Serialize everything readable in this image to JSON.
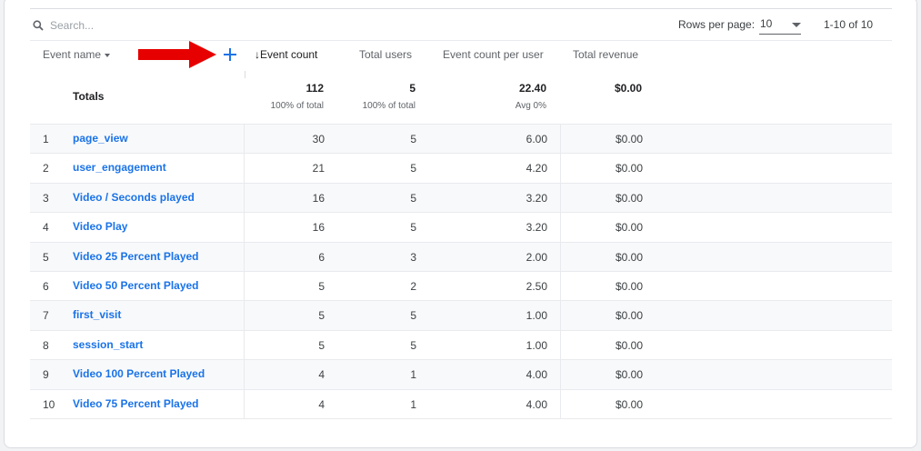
{
  "search": {
    "placeholder": "Search..."
  },
  "pagination": {
    "rows_per_page_label": "Rows per page:",
    "rows_per_page_value": "10",
    "range": "1-10 of 10"
  },
  "columns": {
    "dimension": "Event name",
    "event_count": "Event count",
    "total_users": "Total users",
    "event_count_per_user": "Event count per user",
    "total_revenue": "Total revenue",
    "sort_indicator": "↓"
  },
  "totals": {
    "label": "Totals",
    "event_count": "112",
    "event_count_sub": "100% of total",
    "total_users": "5",
    "total_users_sub": "100% of total",
    "event_count_per_user": "22.40",
    "event_count_per_user_sub": "Avg 0%",
    "total_revenue": "$0.00"
  },
  "rows": [
    {
      "index": "1",
      "event_name": "page_view",
      "event_count": "30",
      "total_users": "5",
      "per_user": "6.00",
      "revenue": "$0.00"
    },
    {
      "index": "2",
      "event_name": "user_engagement",
      "event_count": "21",
      "total_users": "5",
      "per_user": "4.20",
      "revenue": "$0.00"
    },
    {
      "index": "3",
      "event_name": "Video / Seconds played",
      "event_count": "16",
      "total_users": "5",
      "per_user": "3.20",
      "revenue": "$0.00"
    },
    {
      "index": "4",
      "event_name": "Video Play",
      "event_count": "16",
      "total_users": "5",
      "per_user": "3.20",
      "revenue": "$0.00"
    },
    {
      "index": "5",
      "event_name": "Video 25 Percent Played",
      "event_count": "6",
      "total_users": "3",
      "per_user": "2.00",
      "revenue": "$0.00"
    },
    {
      "index": "6",
      "event_name": "Video 50 Percent Played",
      "event_count": "5",
      "total_users": "2",
      "per_user": "2.50",
      "revenue": "$0.00"
    },
    {
      "index": "7",
      "event_name": "first_visit",
      "event_count": "5",
      "total_users": "5",
      "per_user": "1.00",
      "revenue": "$0.00"
    },
    {
      "index": "8",
      "event_name": "session_start",
      "event_count": "5",
      "total_users": "5",
      "per_user": "1.00",
      "revenue": "$0.00"
    },
    {
      "index": "9",
      "event_name": "Video 100 Percent Played",
      "event_count": "4",
      "total_users": "1",
      "per_user": "4.00",
      "revenue": "$0.00"
    },
    {
      "index": "10",
      "event_name": "Video 75 Percent Played",
      "event_count": "4",
      "total_users": "1",
      "per_user": "4.00",
      "revenue": "$0.00"
    }
  ],
  "icons": {
    "search": "search-icon",
    "add": "add-icon",
    "arrow": "red-arrow-annotation",
    "dropdown": "chevron-down-icon"
  },
  "colors": {
    "link": "#1a73e8",
    "annotation_arrow": "#e60000",
    "row_shade": "#f8f9fa"
  }
}
